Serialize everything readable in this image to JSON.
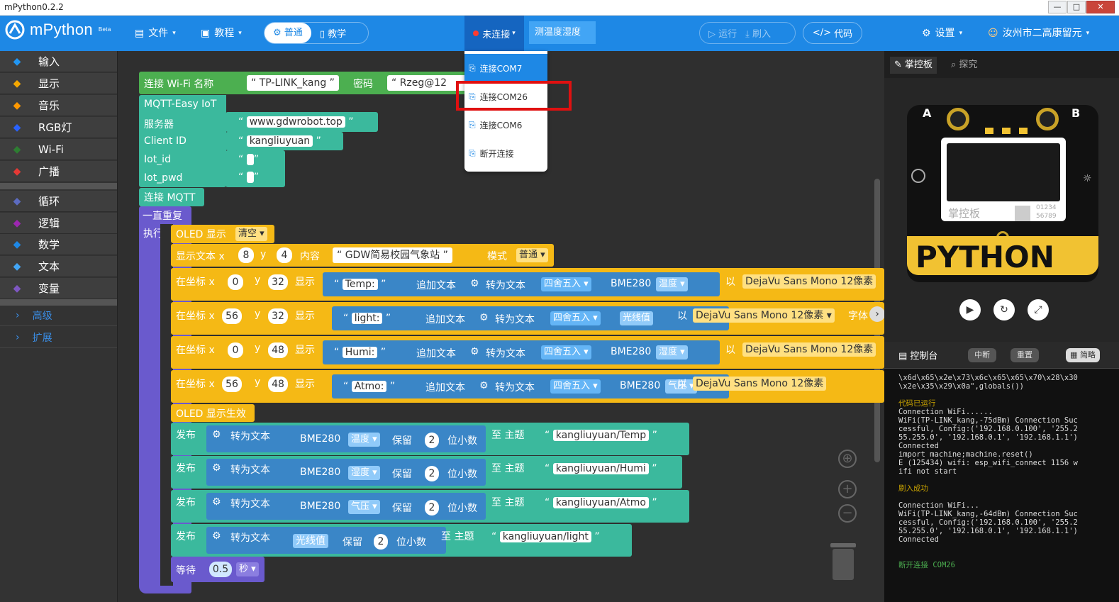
{
  "window": {
    "title": "mPython0.2.2",
    "minimize": "—",
    "maximize": "□",
    "close": "✕"
  },
  "header": {
    "app_name": "mPython",
    "beta": "Beta",
    "file": "文件",
    "tutorial": "教程",
    "mode_normal": "普通",
    "mode_teach": "教学",
    "connection_status": "未连接",
    "sensor_title": "测温度湿度",
    "run": "运行",
    "flash": "刷入",
    "code": "代码",
    "settings": "设置",
    "user": "汝州市二高康留元"
  },
  "dropdown": {
    "items": [
      "连接COM7",
      "连接COM26",
      "连接COM6",
      "断开连接"
    ],
    "selected": "连接COM7"
  },
  "sidebar": {
    "categories": [
      {
        "label": "输入",
        "color": "#2196f3",
        "icon": "input-icon"
      },
      {
        "label": "显示",
        "color": "#f4a700",
        "icon": "display-icon"
      },
      {
        "label": "音乐",
        "color": "#ff9800",
        "icon": "music-icon"
      },
      {
        "label": "RGB灯",
        "color": "#2962ff",
        "icon": "rgb-icon"
      },
      {
        "label": "Wi-Fi",
        "color": "#2e7d32",
        "icon": "wifi-icon"
      },
      {
        "label": "广播",
        "color": "#e53935",
        "icon": "broadcast-icon"
      },
      {
        "label": "循环",
        "color": "#5c6bc0",
        "icon": "loop-icon"
      },
      {
        "label": "逻辑",
        "color": "#9c27b0",
        "icon": "logic-icon"
      },
      {
        "label": "数学",
        "color": "#1e88e5",
        "icon": "math-icon"
      },
      {
        "label": "文本",
        "color": "#42a5f5",
        "icon": "text-icon"
      },
      {
        "label": "变量",
        "color": "#7e57c2",
        "icon": "variable-icon"
      }
    ],
    "advanced": "高级",
    "extension": "扩展"
  },
  "blocks": {
    "wifi_connect": "连接 Wi-Fi 名称",
    "wifi_ssid": "TP-LINK_kang",
    "password_label": "密码",
    "password_value": "Rzeg@12",
    "mqtt_title": "MQTT-Easy IoT",
    "server_label": "服务器",
    "server_value": "www.gdwrobot.top",
    "client_id_label": "Client ID",
    "client_id_value": "kangliuyuan",
    "iot_id_label": "Iot_id",
    "iot_pwd_label": "Iot_pwd",
    "connect_mqtt": "连接 MQTT",
    "forever": "一直重复",
    "do": "执行",
    "oled_show": "OLED 显示",
    "clear": "清空",
    "show_text_x": "显示文本 x",
    "y": "y",
    "content": "内容",
    "mode": "模式",
    "normal": "普通",
    "text1_x": "8",
    "text1_y": "4",
    "text1_content": "GDW简易校园气象站",
    "at_coord_x": "在坐标 x",
    "show": "显示",
    "append_text": "追加文本",
    "to_text": "转为文本",
    "round": "四舍五入",
    "with": "以",
    "font": "DejaVu Sans Mono 12像素",
    "font_label": "字体",
    "bme280": "BME280",
    "temperature": "温度",
    "humidity": "湿度",
    "pressure": "气压",
    "light_value": "光线值",
    "rows": [
      {
        "x": "0",
        "y": "32",
        "label": "Temp:",
        "sensor": "BME280",
        "field": "温度"
      },
      {
        "x": "56",
        "y": "32",
        "label": "light:",
        "sensor": "",
        "field": "光线值"
      },
      {
        "x": "0",
        "y": "48",
        "label": "Humi:",
        "sensor": "BME280",
        "field": "湿度"
      },
      {
        "x": "56",
        "y": "48",
        "label": "Atmo:",
        "sensor": "BME280",
        "field": "气压"
      }
    ],
    "oled_commit": "OLED 显示生效",
    "publish": "发布",
    "keep": "保留",
    "decimals": "位小数",
    "to_topic": "至 主题",
    "pubs": [
      {
        "field": "温度",
        "digits": "2",
        "topic": "kangliuyuan/Temp"
      },
      {
        "field": "湿度",
        "digits": "2",
        "topic": "kangliuyuan/Humi"
      },
      {
        "field": "气压",
        "digits": "2",
        "topic": "kangliuyuan/Atmo"
      },
      {
        "field": "光线值",
        "digits": "2",
        "topic": "kangliuyuan/light"
      }
    ],
    "wait": "等待",
    "wait_value": "0.5",
    "seconds": "秒"
  },
  "right_panel": {
    "tab_board": "掌控板",
    "tab_explore": "探究",
    "board_logo": "掌控板",
    "board_digits1": "01234",
    "board_digits2": "56789",
    "btn_a": "A",
    "btn_b": "B",
    "console_title": "控制台",
    "console_interrupt": "中断",
    "console_reset": "重置",
    "console_simple": "简略",
    "log": [
      {
        "text": "\\x6d\\x65\\x2e\\x73\\x6c\\x65\\x65\\x70\\x28\\x30",
        "type": "n"
      },
      {
        "text": "\\x2e\\x35\\x29\\x0a\",globals())",
        "type": "n"
      },
      {
        "text": "",
        "type": "n"
      },
      {
        "text": "代码已运行",
        "type": "y"
      },
      {
        "text": "Connection WiFi......",
        "type": "n"
      },
      {
        "text": "WiFi(TP-LINK_kang,-75dBm) Connection Suc",
        "type": "n"
      },
      {
        "text": "cessful, Config:('192.168.0.100', '255.2",
        "type": "n"
      },
      {
        "text": "55.255.0', '192.168.0.1', '192.168.1.1')",
        "type": "n"
      },
      {
        "text": "Connected",
        "type": "n"
      },
      {
        "text": "import machine;machine.reset()",
        "type": "n"
      },
      {
        "text": "E (125434) wifi: esp_wifi_connect 1156 w",
        "type": "n"
      },
      {
        "text": "ifi not start",
        "type": "n"
      },
      {
        "text": "",
        "type": "n"
      },
      {
        "text": "刷入成功",
        "type": "y"
      },
      {
        "text": "",
        "type": "n"
      },
      {
        "text": "Connection WiFi...",
        "type": "n"
      },
      {
        "text": "WiFi(TP-LINK_kang,-64dBm) Connection Suc",
        "type": "n"
      },
      {
        "text": "cessful, Config:('192.168.0.100', '255.2",
        "type": "n"
      },
      {
        "text": "55.255.0', '192.168.0.1', '192.168.1.1')",
        "type": "n"
      },
      {
        "text": "Connected",
        "type": "n"
      },
      {
        "text": "",
        "type": "n"
      },
      {
        "text": "",
        "type": "n"
      },
      {
        "text": "断开连接 COM26",
        "type": "g"
      }
    ]
  }
}
